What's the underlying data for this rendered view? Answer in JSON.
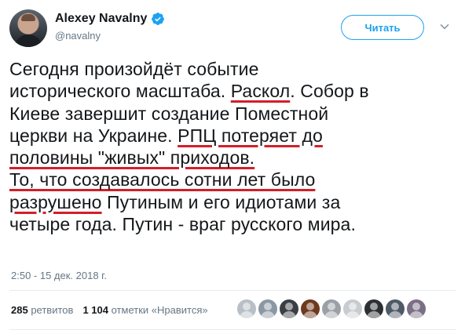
{
  "user": {
    "name": "Alexey Navalny",
    "handle": "@navalny"
  },
  "follow_label": "Читать",
  "tweet_lines": [
    [
      {
        "t": "Сегодня произойдёт событие",
        "u": false
      }
    ],
    [
      {
        "t": "исторического масштаба. ",
        "u": false
      },
      {
        "t": "Раскол",
        "u": true
      },
      {
        "t": ". Собор в",
        "u": false
      }
    ],
    [
      {
        "t": "Киеве завершит создание Поместной",
        "u": false
      }
    ],
    [
      {
        "t": "церкви на Украине. ",
        "u": false
      },
      {
        "t": "РПЦ потеряет до",
        "u": true
      }
    ],
    [
      {
        "t": "половины \"живых\" приходов.",
        "u": true
      }
    ],
    [
      {
        "t": "То, что создавалось сотни лет было",
        "u": true
      }
    ],
    [
      {
        "t": "разрушено",
        "u": true
      },
      {
        "t": " Путиным и его идиотами за",
        "u": false
      }
    ],
    [
      {
        "t": "четыре года. Путин - враг русского мира.",
        "u": false
      }
    ]
  ],
  "timestamp": "2:50 - 15 дек. 2018 г.",
  "stats": {
    "retweets_count": "285",
    "retweets_label": "ретвитов",
    "likes_count": "1 104",
    "likes_label": "отметки «Нравится»"
  },
  "likers_count": 9,
  "colors": {
    "accent": "#1da1f2",
    "underline": "#d21f2a"
  }
}
